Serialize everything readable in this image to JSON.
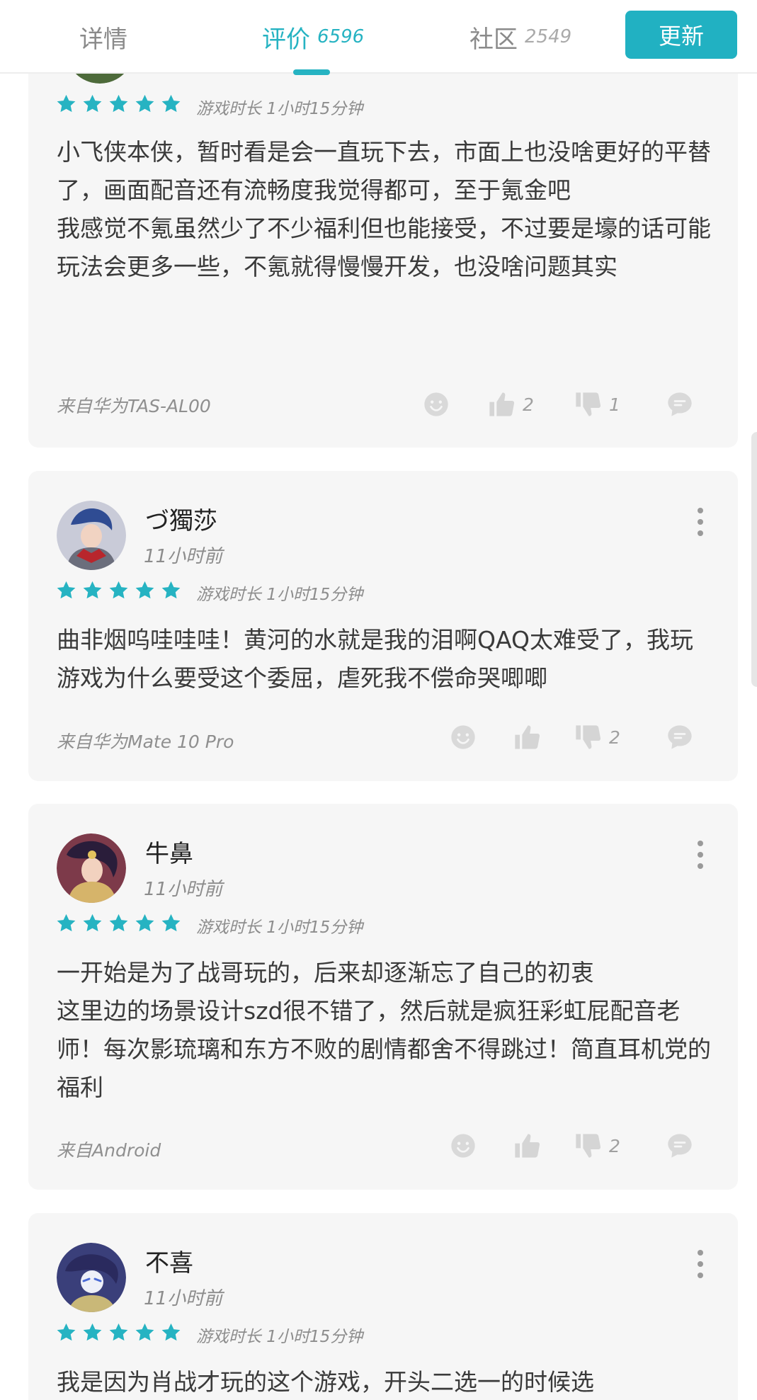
{
  "tabs": [
    {
      "label": "详情",
      "count": ""
    },
    {
      "label": "评价",
      "count": "6596"
    },
    {
      "label": "社区",
      "count": "2549"
    }
  ],
  "update_button": "更新",
  "accent_color": "#26b3c2",
  "star_color": "#26b3c2",
  "reviews": [
    {
      "username": "",
      "time": "",
      "rating": 5,
      "playtime": "游戏时长 1小时15分钟",
      "text": "小飞侠本侠，暂时看是会一直玩下去，市面上也没啥更好的平替了，画面配音还有流畅度我觉得都可，至于氪金吧\n我感觉不氪虽然少了不少福利但也能接受，不过要是壕的话可能玩法会更多一些，不氪就得慢慢开发，也没啥问题其实",
      "device": "来自华为TAS-AL00",
      "likes": "2",
      "dislikes": "1"
    },
    {
      "username": "づ獨莎",
      "time": "11小时前",
      "rating": 5,
      "playtime": "游戏时长 1小时15分钟",
      "text": "曲非烟呜哇哇哇！黄河的水就是我的泪啊QAQ太难受了，我玩游戏为什么要受这个委屈，虐死我不偿命哭唧唧",
      "device": "来自华为Mate 10 Pro",
      "likes": "",
      "dislikes": "2"
    },
    {
      "username": "牛鼻",
      "time": "11小时前",
      "rating": 5,
      "playtime": "游戏时长 1小时15分钟",
      "text": "一开始是为了战哥玩的，后来却逐渐忘了自己的初衷\n这里边的场景设计szd很不错了，然后就是疯狂彩虹屁配音老师！每次影琉璃和东方不败的剧情都舍不得跳过！简直耳机党的福利",
      "device": "来自Android",
      "likes": "",
      "dislikes": "2"
    },
    {
      "username": "不喜",
      "time": "11小时前",
      "rating": 5,
      "playtime": "游戏时长 1小时15分钟",
      "text": "我是因为肖战才玩的这个游戏，开头二选一的时候选",
      "device": "",
      "likes": "",
      "dislikes": ""
    }
  ]
}
